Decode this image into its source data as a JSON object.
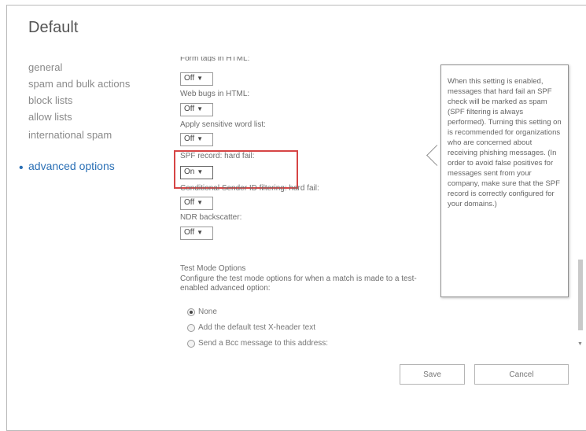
{
  "page": {
    "title": "Default"
  },
  "nav": {
    "items": [
      {
        "label": "general"
      },
      {
        "label": "spam and bulk actions"
      },
      {
        "label": "block lists"
      },
      {
        "label": "allow lists"
      },
      {
        "label": "international spam"
      },
      {
        "label": "advanced options"
      }
    ],
    "active": "advanced options"
  },
  "settings": {
    "form_tags_label": "Form tags in HTML:",
    "form_tags_value": "Off",
    "web_bugs_label": "Web bugs in HTML:",
    "web_bugs_value": "Off",
    "sensitive_label": "Apply sensitive word list:",
    "sensitive_value": "Off",
    "spf_label": "SPF record: hard fail:",
    "spf_value": "On",
    "sender_id_label": "Conditional Sender ID filtering: hard fail:",
    "sender_id_value": "Off",
    "ndr_label": "NDR backscatter:",
    "ndr_value": "Off"
  },
  "tooltip": {
    "text": "When this setting is enabled, messages that hard fail an SPF check will be marked as spam (SPF filtering is always performed). Turning this setting on is recommended for organizations who are concerned about receiving phishing messages. (In order to avoid false positives for messages sent from your company, make sure that the SPF record is correctly configured for your domains.)"
  },
  "test_mode": {
    "title": "Test Mode Options",
    "description": "Configure the test mode options for when a match is made to a test-enabled advanced option:",
    "options": [
      {
        "label": "None",
        "selected": true
      },
      {
        "label": "Add the default test X-header text",
        "selected": false
      },
      {
        "label": "Send a Bcc message to this address:",
        "selected": false
      }
    ]
  },
  "buttons": {
    "save": "Save",
    "cancel": "Cancel"
  },
  "colors": {
    "accent": "#2a6fb5",
    "highlight_border": "#d64545"
  }
}
